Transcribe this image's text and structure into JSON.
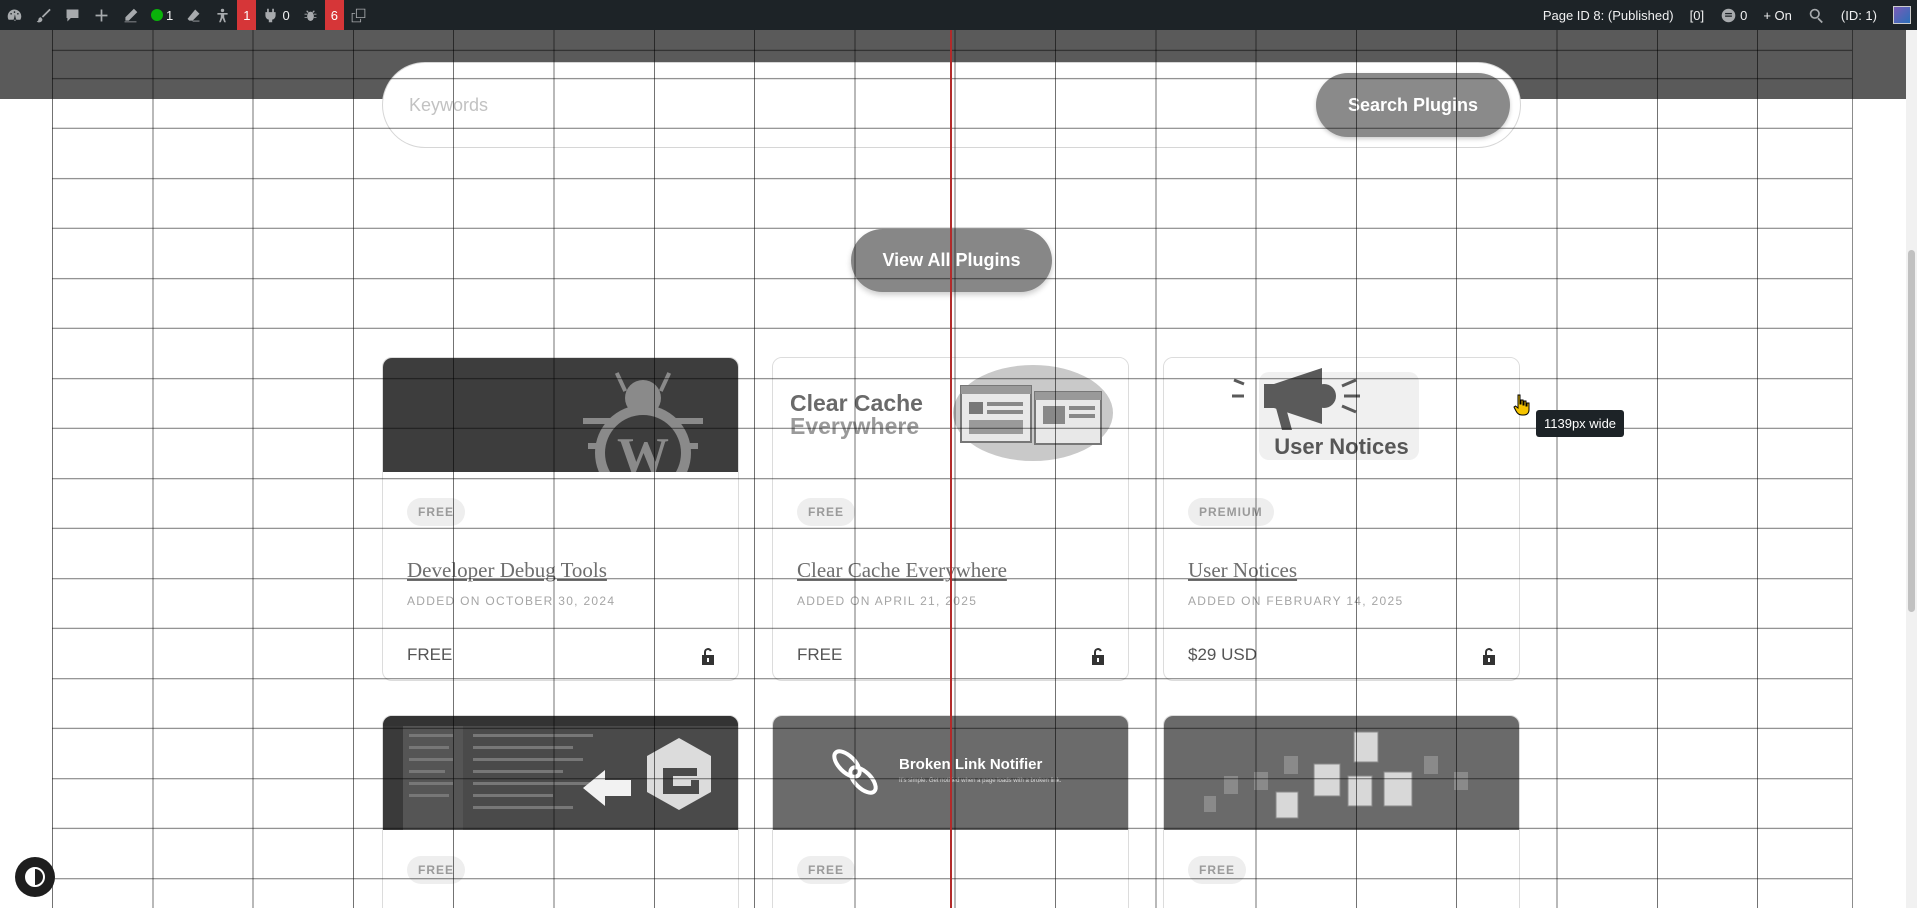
{
  "adminbar": {
    "comments_count": "1",
    "accessibility_count": "1",
    "plugins_count": "0",
    "bugs_count": "6",
    "page_id": "Page ID 8: (Published)",
    "bracket": "[0]",
    "notes_count": "0",
    "toggle_label": "+ On",
    "user_id": "(ID: 1)"
  },
  "search": {
    "placeholder": "Keywords",
    "button_label": "Search Plugins"
  },
  "view_all_label": "View All Plugins",
  "cards": [
    {
      "badge": "FREE",
      "title": "Developer Debug Tools",
      "date": "ADDED ON OCTOBER 30, 2024",
      "price": "FREE"
    },
    {
      "badge": "FREE",
      "title": "Clear Cache Everywhere",
      "date": "ADDED ON APRIL 21, 2025",
      "price": "FREE",
      "image_text": [
        "Clear Cache",
        "Everywhere"
      ]
    },
    {
      "badge": "PREMIUM",
      "title": "User Notices",
      "date": "ADDED ON FEBRUARY 14, 2025",
      "price": "$29 USD",
      "image_text": "User Notices"
    },
    {
      "badge": "FREE"
    },
    {
      "badge": "FREE",
      "image_title": "Broken Link Notifier",
      "image_subtitle": "It's simple. Get notified when a page loads with a broken link."
    },
    {
      "badge": "FREE"
    }
  ],
  "tooltip": "1139px wide"
}
